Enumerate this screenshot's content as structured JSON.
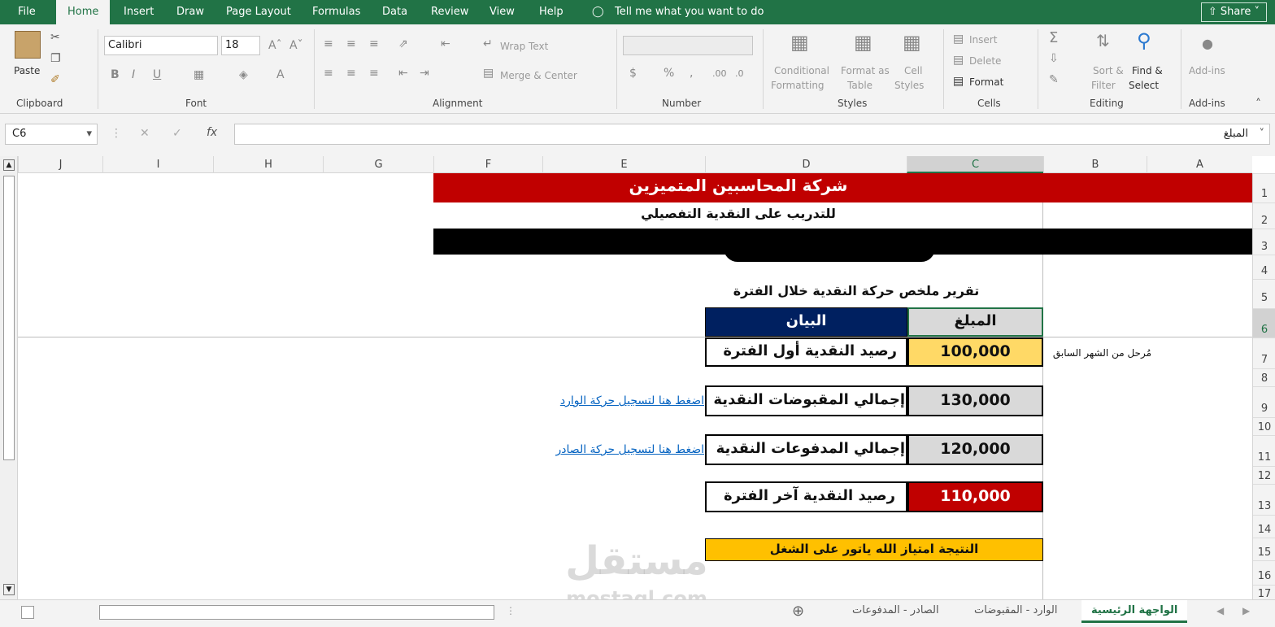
{
  "menu": {
    "file": "File",
    "home": "Home",
    "insert": "Insert",
    "draw": "Draw",
    "page_layout": "Page Layout",
    "formulas": "Formulas",
    "data": "Data",
    "review": "Review",
    "view": "View",
    "help": "Help",
    "tell_me": "Tell me what you want to do",
    "share": "Share"
  },
  "ribbon": {
    "clipboard": {
      "paste": "Paste",
      "label": "Clipboard"
    },
    "font": {
      "name": "Calibri",
      "size": "18",
      "label": "Font"
    },
    "alignment": {
      "wrap_text": "Wrap Text",
      "merge_center": "Merge & Center",
      "label": "Alignment"
    },
    "number": {
      "currency": "$",
      "percent": "%",
      "comma": ",",
      "label": "Number"
    },
    "styles": {
      "conditional": "Conditional",
      "formatting": "Formatting",
      "format_as": "Format as",
      "table": "Table",
      "cell": "Cell",
      "styles": "Styles",
      "label": "Styles"
    },
    "cells": {
      "insert": "Insert",
      "delete": "Delete",
      "format": "Format",
      "label": "Cells"
    },
    "editing": {
      "sort": "Sort &",
      "filter": "Filter",
      "find": "Find &",
      "select": "Select",
      "label": "Editing"
    },
    "addins": {
      "addins": "Add-ins",
      "label": "Add-ins"
    }
  },
  "formula_bar": {
    "name_box": "C6",
    "fx": "fx",
    "content": "المبلغ"
  },
  "columns": [
    "J",
    "I",
    "H",
    "G",
    "F",
    "E",
    "D",
    "C",
    "B",
    "A"
  ],
  "rows": [
    "1",
    "2",
    "3",
    "4",
    "5",
    "6",
    "7",
    "8",
    "9",
    "10",
    "11",
    "12",
    "13",
    "14",
    "15",
    "16",
    "17"
  ],
  "sheet": {
    "company": "شركة المحاسبين المتميزين",
    "subtitle": "للتدريب على النقدية التفصيلي",
    "report_title": "تقرير ملخص حركة النقدية خلال الفترة",
    "header_amount": "المبلغ",
    "header_desc": "البيان",
    "rows": [
      {
        "desc": "رصيد النقدية أول الفترة",
        "amount": "100,000",
        "note": "مُرحل من الشهر السابق"
      },
      {
        "desc": "إجمالي المقبوضات النقدية",
        "amount": "130,000",
        "link": "اضغط هنا لتسجيل حركة الوارد"
      },
      {
        "desc": "إجمالي المدفوعات النقدية",
        "amount": "120,000",
        "link": "اضغط هنا لتسجيل حركة الصادر"
      },
      {
        "desc": "رصيد النقدية آخر الفترة",
        "amount": "110,000"
      }
    ],
    "result": "النتيجة امتياز الله ياتور على الشغل"
  },
  "tabs": [
    "الواجهة الرئيسية",
    "الوارد - المقبوضات",
    "الصادر - المدفوعات"
  ],
  "watermark": {
    "arabic": "مستقل",
    "latin": "mostaql.com"
  },
  "colors": {
    "excel_green": "#217346",
    "title_red": "#c00000",
    "header_navy": "#002060",
    "yellow": "#ffc000",
    "light_yellow": "#ffd966",
    "gray": "#d9d9d9",
    "link": "#0563c1"
  }
}
